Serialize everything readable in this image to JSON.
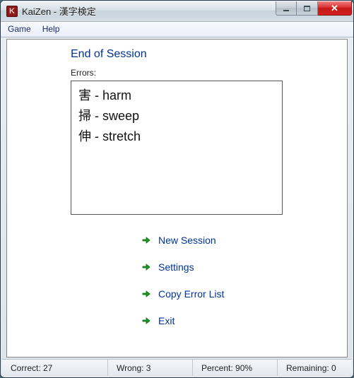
{
  "window": {
    "title": "KaiZen - 漢字検定",
    "icon_letter": "K"
  },
  "menu": {
    "game": "Game",
    "help": "Help"
  },
  "session": {
    "heading": "End of Session",
    "errors_label": "Errors:",
    "errors": [
      "害 - harm",
      "掃 - sweep",
      "伸 - stretch"
    ]
  },
  "actions": {
    "new_session": "New Session",
    "settings": "Settings",
    "copy_errors": "Copy Error List",
    "exit": "Exit"
  },
  "status": {
    "correct": "Correct: 27",
    "wrong": "Wrong: 3",
    "percent": "Percent: 90%",
    "remaining": "Remaining: 0"
  }
}
